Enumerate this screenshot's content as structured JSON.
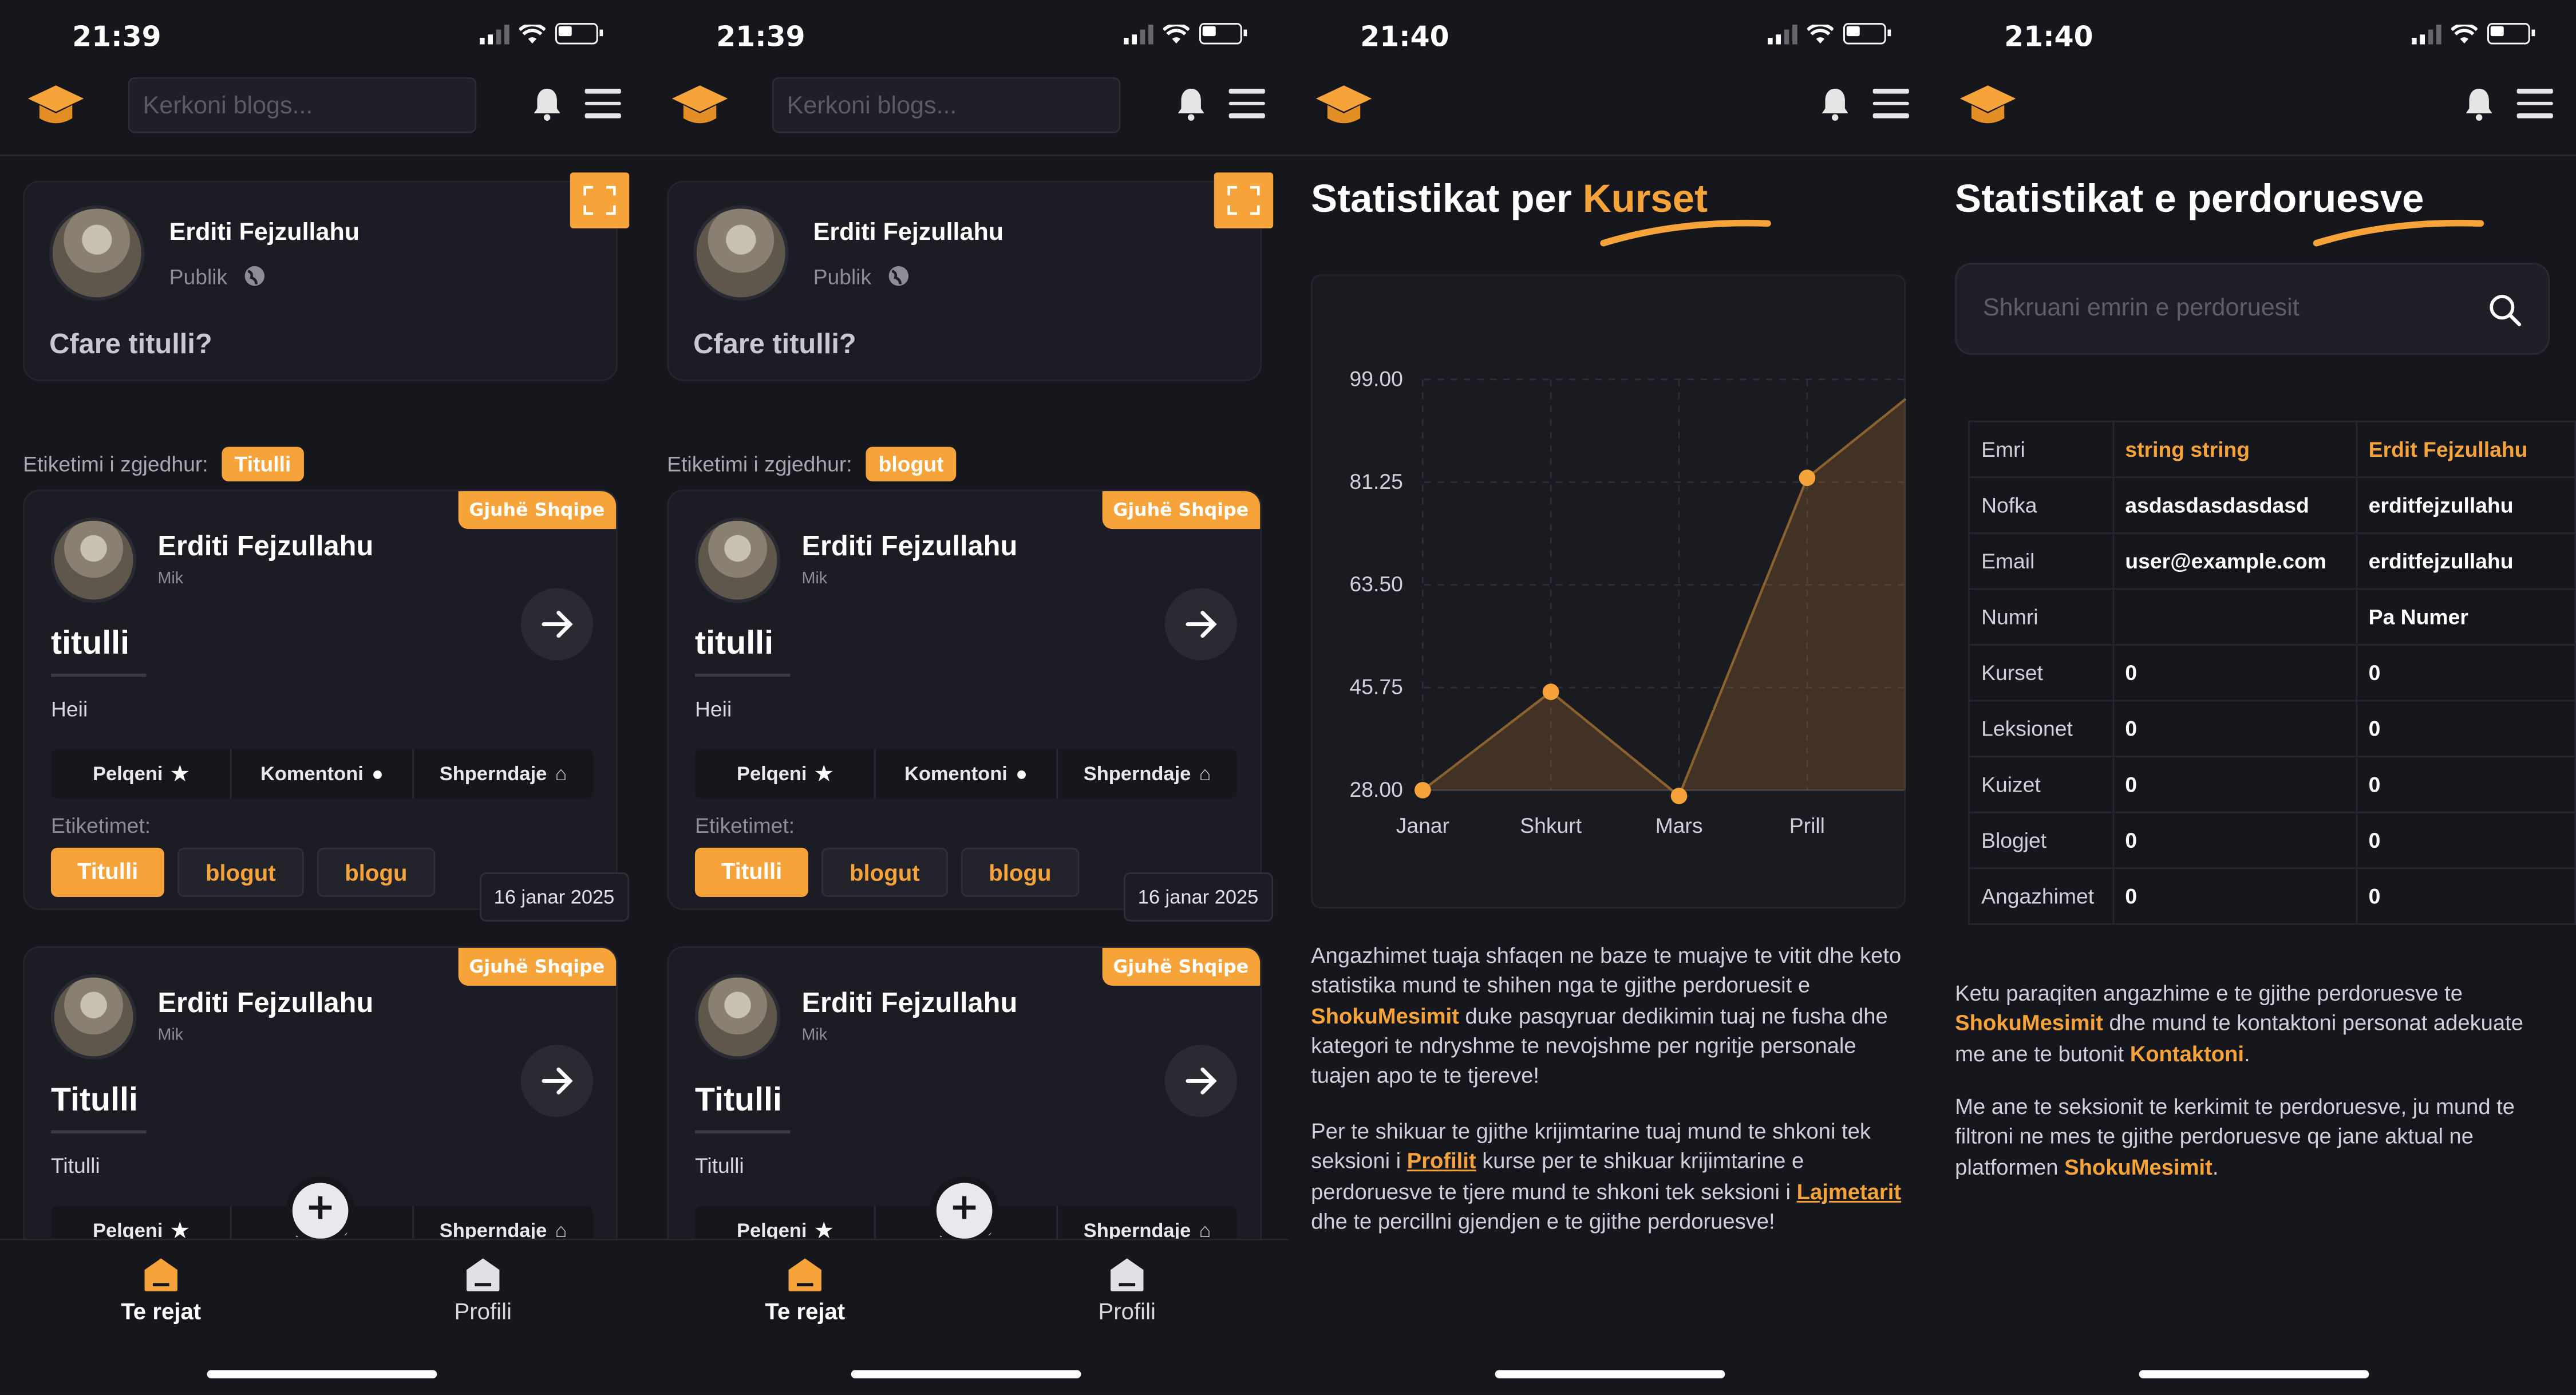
{
  "colors": {
    "accent": "#f6a33a",
    "background": "#16161d",
    "card": "#1c1c24"
  },
  "screens": [
    {
      "time": "21:39",
      "search_placeholder": "Kerkoni blogs...",
      "composer": {
        "name": "Erditi Fejzullahu",
        "visibility": "Publik",
        "prompt": "Cfare titulli?"
      },
      "filter_label": "Etiketimi i zgjedhur:",
      "filter_value": "Titulli",
      "posts": [
        {
          "lang": "Gjuhë Shqipe",
          "author": "Erditi Fejzullahu",
          "role": "Mik",
          "title": "titulli",
          "body": "Heii",
          "like": "Pelqeni",
          "comment": "Komentoni",
          "share": "Shperndaje",
          "tags_label": "Etiketimet:",
          "tags": [
            "Titulli",
            "blogut",
            "blogu"
          ],
          "date": "16 janar 2025"
        },
        {
          "lang": "Gjuhë Shqipe",
          "author": "Erditi Fejzullahu",
          "role": "Mik",
          "title": "Titulli",
          "body": "Titulli",
          "like": "Pelqeni",
          "comment": "Kor",
          "share": "Shperndaje"
        }
      ],
      "nav": {
        "home": "Te rejat",
        "profile": "Profili"
      }
    },
    {
      "time": "21:39",
      "search_placeholder": "Kerkoni blogs...",
      "composer": {
        "name": "Erditi Fejzullahu",
        "visibility": "Publik",
        "prompt": "Cfare titulli?"
      },
      "filter_label": "Etiketimi i zgjedhur:",
      "filter_value": "blogut",
      "posts": [
        {
          "lang": "Gjuhë Shqipe",
          "author": "Erditi Fejzullahu",
          "role": "Mik",
          "title": "titulli",
          "body": "Heii",
          "like": "Pelqeni",
          "comment": "Komentoni",
          "share": "Shperndaje",
          "tags_label": "Etiketimet:",
          "tags": [
            "Titulli",
            "blogut",
            "blogu"
          ],
          "date": "16 janar 2025"
        },
        {
          "lang": "Gjuhë Shqipe",
          "author": "Erditi Fejzullahu",
          "role": "Mik",
          "title": "Titulli",
          "body": "Titulli",
          "like": "Pelqeni",
          "comment": "Kor",
          "share": "Shperndaje"
        }
      ],
      "nav": {
        "home": "Te rejat",
        "profile": "Profili"
      }
    },
    {
      "time": "21:40",
      "title_main": "Statistikat per",
      "title_accent": "Kurset",
      "p1_a": "Angazhimet tuaja shfaqen ne baze te muajve te vitit dhe keto statistika mund te shihen nga te gjithe perdoruesit e ",
      "p1_b": "ShokuMesimit",
      "p1_c": " duke pasqyruar dedikimin tuaj ne fusha dhe kategori te ndryshme te nevojshme per ngritje personale tuajen apo te te tjereve!",
      "p2_a": "Per te shikuar te gjithe krijimtarine tuaj mund te shkoni tek seksioni i ",
      "p2_b": "Profilit",
      "p2_c": " kurse per te shikuar krijimtarine e perdoruesve te tjere mund te shkoni tek seksioni i ",
      "p2_d": "Lajmetarit",
      "p2_e": " dhe te percillni gjendjen e te gjithe perdoruesve!"
    },
    {
      "time": "21:40",
      "title": "Statistikat e perdoruesve",
      "search_placeholder": "Shkruani emrin e perdoruesit",
      "table": [
        [
          "Emri",
          "string string",
          "Erdit Fejzullahu"
        ],
        [
          "Nofka",
          "asdasdasdasdasd",
          "erditfejzullahu"
        ],
        [
          "Email",
          "user@example.com",
          "erditfejzullahu"
        ],
        [
          "Numri",
          "",
          "Pa Numer"
        ],
        [
          "Kurset",
          "0",
          "0"
        ],
        [
          "Leksionet",
          "0",
          "0"
        ],
        [
          "Kuizet",
          "0",
          "0"
        ],
        [
          "Blogjet",
          "0",
          "0"
        ],
        [
          "Angazhimet",
          "0",
          "0"
        ]
      ],
      "p1_a": "Ketu paraqiten angazhime e te gjithe perdoruesve te ",
      "p1_b": "ShokuMesimit",
      "p1_c": " dhe mund te kontaktoni personat adekuate me ane te butonit ",
      "p1_d": "Kontaktoni",
      "p1_e": ".",
      "p2_a": "Me ane te seksionit te kerkimit te perdoruesve, ju mund te filtroni ne mes te gjithe perdoruesve qe jane aktual ne platformen ",
      "p2_b": "ShokuMesimit",
      "p2_c": "."
    }
  ],
  "chart_data": {
    "type": "area",
    "categories": [
      "Janar",
      "Shkurt",
      "Mars",
      "Prill"
    ],
    "values": [
      28,
      45,
      27,
      82
    ],
    "yticks": [
      "99.00",
      "81.25",
      "63.50",
      "45.75",
      "28.00"
    ],
    "ylim": [
      28,
      99
    ],
    "grid": true
  }
}
